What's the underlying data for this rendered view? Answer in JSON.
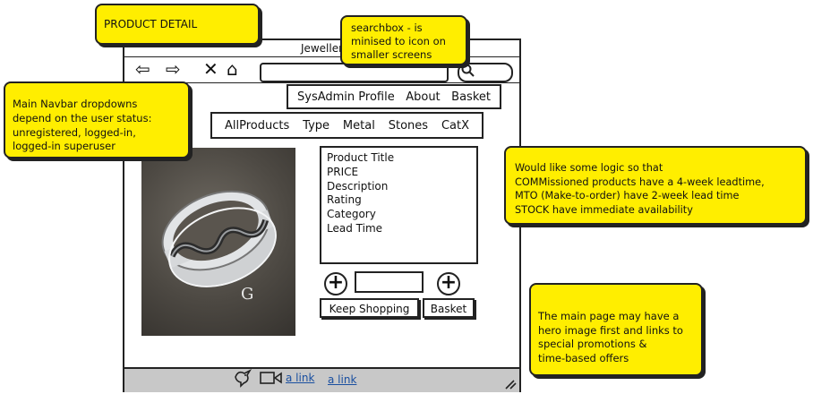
{
  "notes": {
    "product_detail": "PRODUCT DETAIL",
    "searchbox": [
      "searchbox - is",
      "minised to icon on",
      "smaller screens"
    ],
    "navbar": [
      "Main Navbar dropdowns",
      "depend on the user status:",
      "unregistered, logged-in,",
      "logged-in superuser"
    ],
    "leadtime": [
      "Would like some logic so that",
      "COMMissioned products have a 4-week leadtime,",
      "MTO (Make-to-order) have 2-week lead time",
      "STOCK have immediate availability"
    ],
    "main_page": [
      "The main page may have a",
      "hero image first and links to",
      "special promotions &",
      "time-based offers"
    ]
  },
  "browser": {
    "title": "Jeweller",
    "nav_icons": [
      "back-icon",
      "forward-icon",
      "close-icon",
      "home-icon"
    ]
  },
  "navbar": {
    "items": [
      "SysAdmin Profile",
      "About",
      "Basket"
    ]
  },
  "categories": {
    "items": [
      "AllProducts",
      "Type",
      "Metal",
      "Stones",
      "CatX"
    ]
  },
  "product": {
    "fields": [
      "Product Title",
      "PRICE",
      "Description",
      "Rating",
      "Category",
      "Lead Time"
    ],
    "logo_letter": "G"
  },
  "actions": {
    "keep_shopping": "Keep Shopping",
    "basket": "Basket"
  },
  "footer": {
    "links": [
      "a link",
      "a link"
    ],
    "icons": [
      "bird-icon",
      "video-icon",
      "resize-icon"
    ]
  },
  "colors": {
    "note_bg": "#ffee00",
    "statusbar": "#c8c8c8",
    "link": "#1a4fa0"
  }
}
